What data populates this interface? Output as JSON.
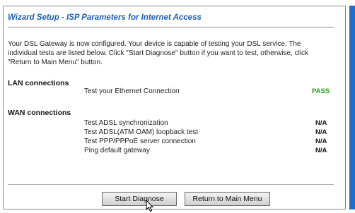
{
  "page": {
    "title": "Wizard Setup - ISP Parameters for Internet Access",
    "intro_lines": [
      "Your DSL Gateway is now configured. Your device is capable of testing your DSL service. The",
      "individual tests are listed below. Click \"Start Diagnose\" button if you want to test, otherwise, click",
      "\"Return to Main Menu\" button."
    ]
  },
  "lan": {
    "heading": "LAN connections",
    "tests": [
      {
        "label": "Test your Ethernet Connection",
        "result": "PASS"
      }
    ]
  },
  "wan": {
    "heading": "WAN connections",
    "tests": [
      {
        "label": "Test ADSL synchronization",
        "result": "N/A"
      },
      {
        "label": "Test ADSL(ATM OAM) loopback test",
        "result": "N/A"
      },
      {
        "label": "Test PPP/PPPoE server connection",
        "result": "N/A"
      },
      {
        "label": "Ping default gateway",
        "result": "N/A"
      }
    ]
  },
  "buttons": {
    "start_label": "Start Diagnose",
    "return_label": "Return to Main Menu"
  },
  "colors": {
    "title": "#1c5fb6",
    "pass": "#2a9e1c",
    "side_strip": "#1f6fd1"
  }
}
